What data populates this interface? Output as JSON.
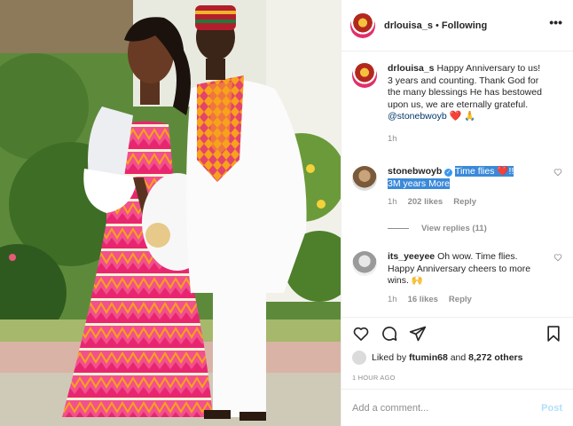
{
  "post": {
    "username": "drlouisa_s",
    "separator": "•",
    "follow_status": "Following",
    "more_label": "•••"
  },
  "caption": {
    "username": "drlouisa_s",
    "text": "Happy Anniversary to us! 3 years and counting. Thank God for the many blessings He has bestowed upon us, we are eternally grateful.",
    "mention": "@stonebwoyb",
    "emoji_heart": "❤️",
    "emoji_pray": "🙏",
    "time": "1h"
  },
  "comments": [
    {
      "username": "stonebwoyb",
      "verified": true,
      "text_highlighted_1": "Time flies ❤️!!",
      "text_highlighted_2": "3M years More",
      "time": "1h",
      "likes": "202 likes",
      "reply": "Reply"
    },
    {
      "username": "its_yeeyee",
      "text": "Oh wow. Time flies. Happy Anniversary cheers to more wins.",
      "emoji": "🙌",
      "time": "1h",
      "likes": "16 likes",
      "reply": "Reply"
    }
  ],
  "view_replies": "View replies (11)",
  "icons": [
    "heart-icon",
    "comment-icon",
    "share-icon",
    "save-icon"
  ],
  "likes": {
    "prefix": "Liked by",
    "user": "ftumin68",
    "connector": "and",
    "others": "8,272 others"
  },
  "timestamp": "1 HOUR AGO",
  "add_comment": {
    "placeholder": "Add a comment...",
    "post_label": "Post"
  },
  "colors": {
    "link_blue": "#00376b",
    "highlight": "#3b8ad9",
    "post_disabled": "#b2dffc",
    "heart_red": "#ed4956",
    "muted": "#8e8e8e"
  }
}
